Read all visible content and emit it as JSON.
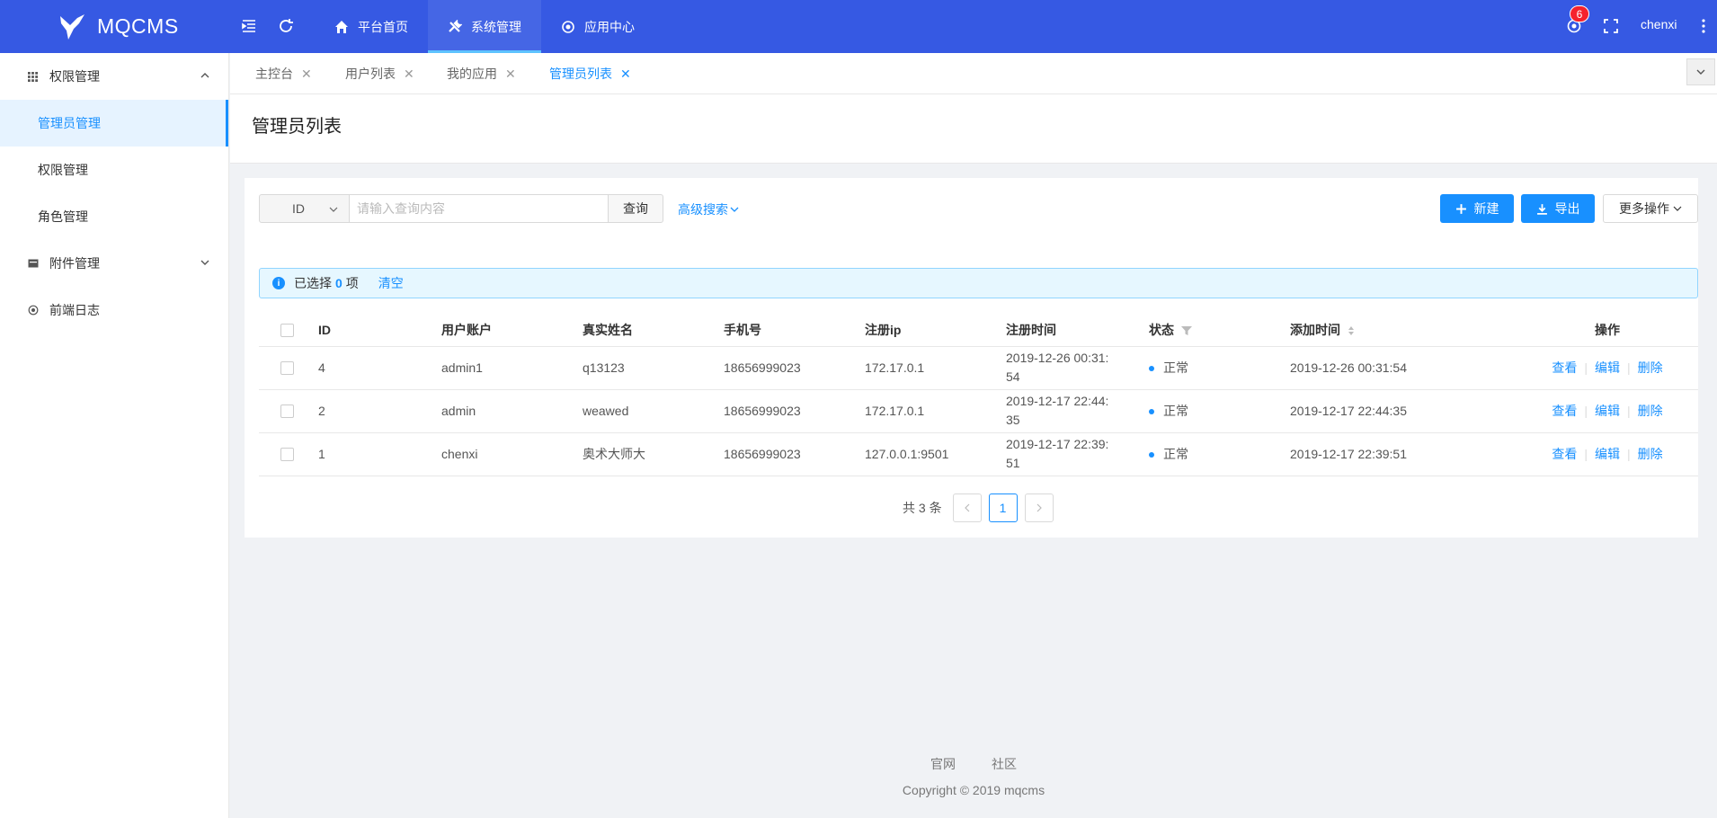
{
  "app": {
    "logo_text": "MQCMS",
    "accent": "#3659e3",
    "primary": "#1890ff"
  },
  "header": {
    "nav": [
      {
        "label": "平台首页",
        "icon": "home-icon"
      },
      {
        "label": "系统管理",
        "icon": "tools-icon"
      },
      {
        "label": "应用中心",
        "icon": "target-icon"
      }
    ],
    "notification_count": "6",
    "username": "chenxi"
  },
  "sidebar": {
    "groups": [
      {
        "label": "权限管理",
        "icon": "grid-icon",
        "expanded": true
      },
      {
        "label": "附件管理",
        "icon": "folder-icon",
        "expanded": false
      },
      {
        "label": "前端日志",
        "icon": "target-icon"
      }
    ],
    "items": [
      {
        "label": "管理员管理",
        "active": true
      },
      {
        "label": "权限管理"
      },
      {
        "label": "角色管理"
      }
    ]
  },
  "tabs": [
    {
      "label": "主控台"
    },
    {
      "label": "用户列表"
    },
    {
      "label": "我的应用"
    },
    {
      "label": "管理员列表",
      "active": true
    }
  ],
  "page": {
    "title": "管理员列表"
  },
  "search": {
    "field": "ID",
    "placeholder": "请输入查询内容",
    "query_label": "查询",
    "advanced_label": "高级搜索"
  },
  "toolbar": {
    "new_label": "新建",
    "export_label": "导出",
    "more_label": "更多操作"
  },
  "alert": {
    "prefix": "已选择",
    "count": "0",
    "suffix": "项",
    "clear": "清空"
  },
  "table": {
    "headers": [
      "ID",
      "用户账户",
      "真实姓名",
      "手机号",
      "注册ip",
      "注册时间",
      "状态",
      "添加时间",
      "操作"
    ],
    "rows": [
      {
        "id": "4",
        "account": "admin1",
        "name": "q13123",
        "phone": "18656999023",
        "ip": "172.17.0.1",
        "reg_time": "2019-12-26 00:31:54",
        "status": "正常",
        "add_time": "2019-12-26 00:31:54"
      },
      {
        "id": "2",
        "account": "admin",
        "name": "weawed",
        "phone": "18656999023",
        "ip": "172.17.0.1",
        "reg_time": "2019-12-17 22:44:35",
        "status": "正常",
        "add_time": "2019-12-17 22:44:35"
      },
      {
        "id": "1",
        "account": "chenxi",
        "name": "奥术大师大",
        "phone": "18656999023",
        "ip": "127.0.0.1:9501",
        "reg_time": "2019-12-17 22:39:51",
        "status": "正常",
        "add_time": "2019-12-17 22:39:51"
      }
    ],
    "actions": {
      "view": "查看",
      "edit": "编辑",
      "delete": "删除"
    }
  },
  "pagination": {
    "total_label": "共 3 条",
    "current": "1"
  },
  "footer": {
    "links": [
      "官网",
      "社区"
    ],
    "copyright": "Copyright © 2019 mqcms"
  }
}
